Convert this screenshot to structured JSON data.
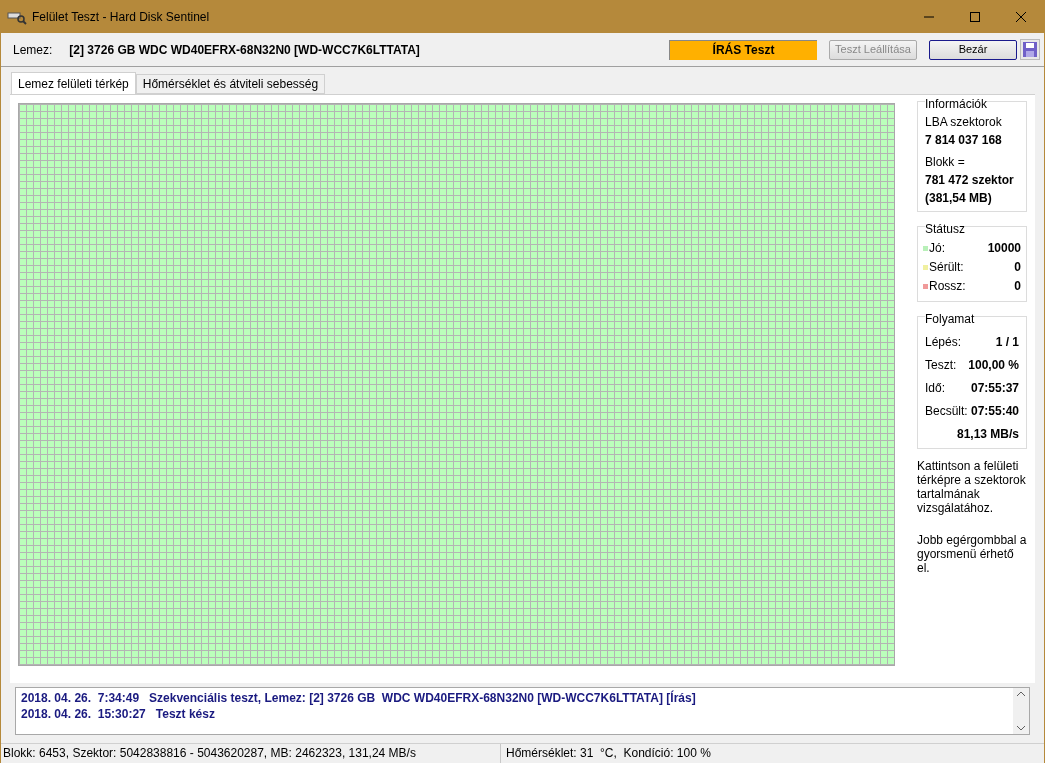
{
  "window": {
    "title": "Felület Teszt - Hard Disk Sentinel"
  },
  "disk": {
    "label": "Lemez:",
    "value": "[2] 3726 GB  WDC WD40EFRX-68N32N0 [WD-WCC7K6LTTATA]"
  },
  "mode_indicator": "ÍRÁS Teszt",
  "buttons": [
    {
      "label": "Teszt Leállítása",
      "disabled": true
    },
    {
      "label": "Bezár",
      "disabled": false
    }
  ],
  "tabs": [
    {
      "label": "Lemez felületi térkép",
      "selected": true
    },
    {
      "label": "Hőmérséklet és átviteli sebesség",
      "selected": false
    }
  ],
  "info": {
    "title": "Információk",
    "lba_label": "LBA szektorok",
    "lba_value": "7 814 037 168",
    "block_label": "Blokk =",
    "block_value": "781 472 szektor",
    "block_size": "(381,54 MB)"
  },
  "status": {
    "title": "Státusz",
    "items": [
      {
        "label": "Jó:",
        "value": "10000",
        "color": "#b8f0b8"
      },
      {
        "label": "Sérült:",
        "value": "0",
        "color": "#f0f0a0"
      },
      {
        "label": "Rossz:",
        "value": "0",
        "color": "#f09a9a"
      }
    ]
  },
  "progress": {
    "title": "Folyamat",
    "rows": [
      {
        "label": "Lépés:",
        "value": "1 / 1"
      },
      {
        "label": "Teszt:",
        "value": "100,00 %"
      },
      {
        "label": "Idő:",
        "value": "07:55:37"
      },
      {
        "label": "Becsült:",
        "value": "07:55:40"
      }
    ],
    "speed": "81,13 MB/s"
  },
  "hints": [
    "Kattintson a felületi térképre a szektorok tartalmának vizsgálatához.",
    "Jobb egérgombbal a gyorsmenü érhető el."
  ],
  "log": [
    "2018. 04. 26.  7:34:49   Szekvenciális teszt, Lemez: [2] 3726 GB  WDC WD40EFRX-68N32N0 [WD-WCC7K6LTTATA] [Írás]",
    "2018. 04. 26.  15:30:27   Teszt kész"
  ],
  "status_bar": [
    "Blokk: 6453, Szektor: 5042838816 - 5043620287, MB: 2462323, 131,24 MB/s",
    "Hőmérséklet: 31  °C,  Kondíció: 100 %"
  ]
}
